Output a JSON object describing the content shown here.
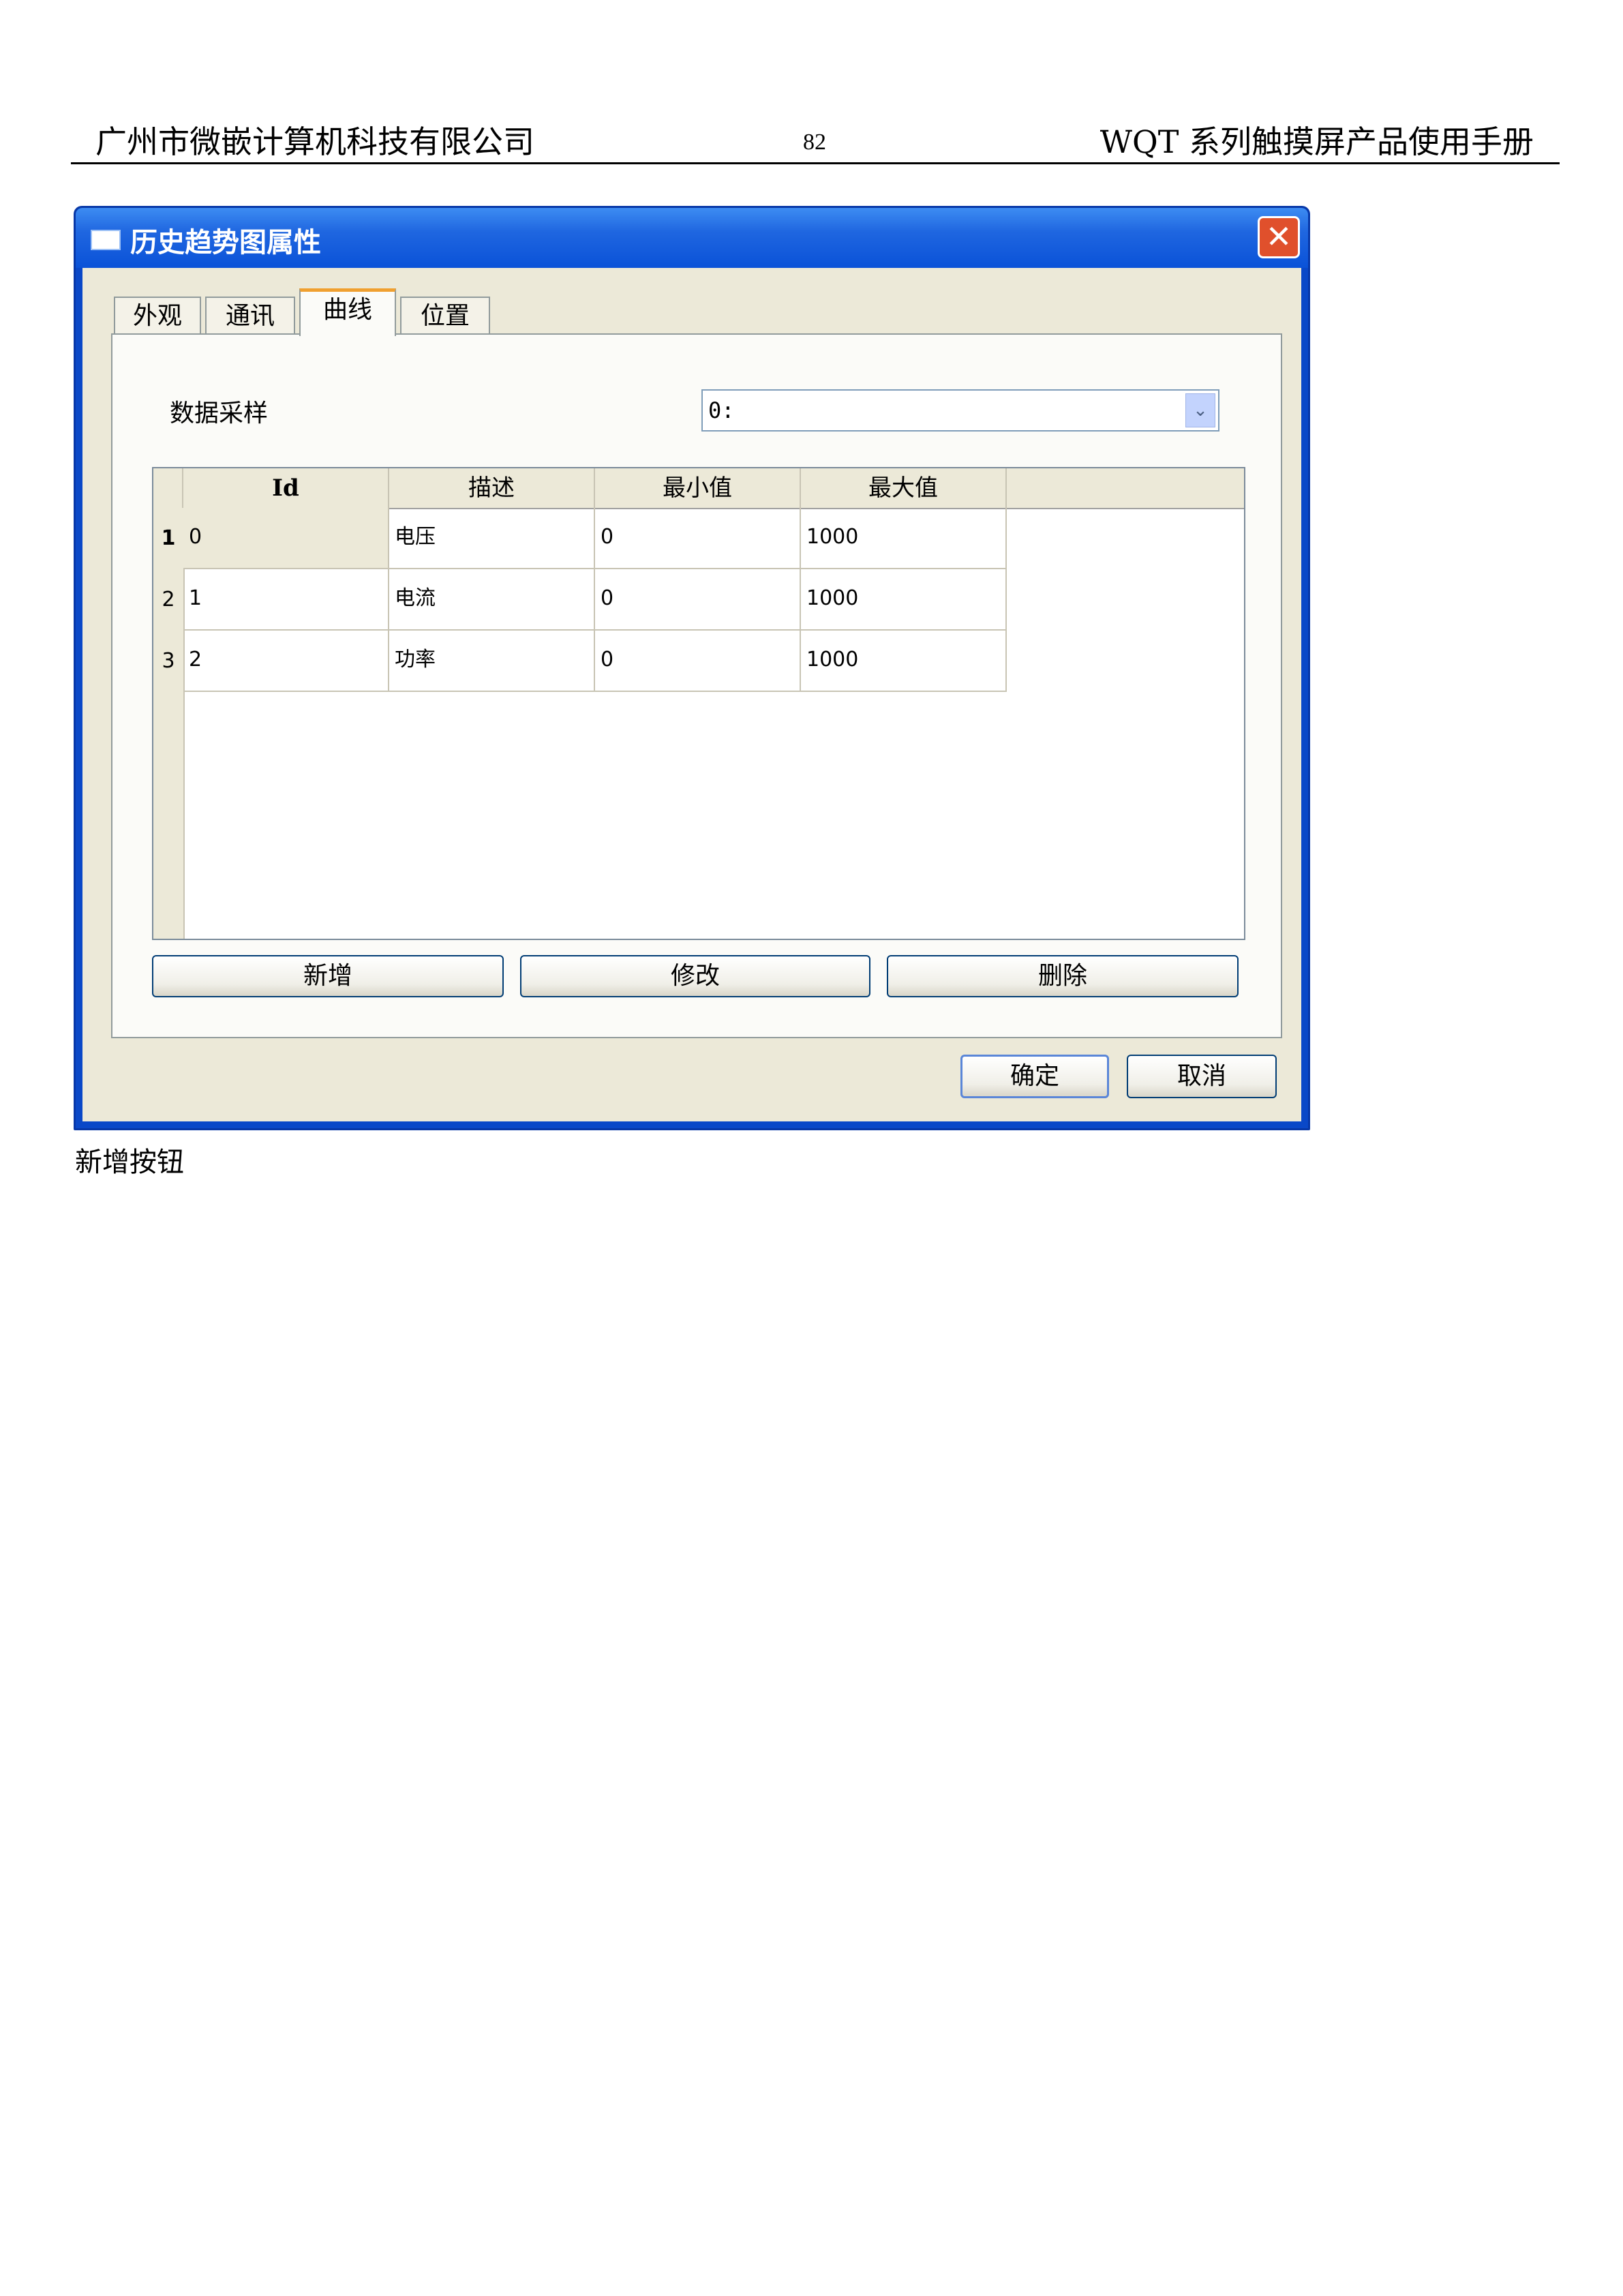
{
  "doc_header": {
    "company": "广州市微嵌计算机科技有限公司",
    "page_number": "82",
    "manual_title": "WQT 系列触摸屏产品使用手册"
  },
  "window": {
    "title": "历史趋势图属性",
    "close_label": "✕"
  },
  "tabs": [
    {
      "label": "外观"
    },
    {
      "label": "通讯"
    },
    {
      "label": "曲线"
    },
    {
      "label": "位置"
    }
  ],
  "active_tab": "曲线",
  "sampling": {
    "label": "数据采样",
    "value": "0:",
    "arrow": "⌄"
  },
  "grid": {
    "columns": [
      "Id",
      "描述",
      "最小值",
      "最大值"
    ],
    "rows": [
      {
        "num": "1",
        "id": "0",
        "desc": "电压",
        "min": "0",
        "max": "1000"
      },
      {
        "num": "2",
        "id": "1",
        "desc": "电流",
        "min": "0",
        "max": "1000"
      },
      {
        "num": "3",
        "id": "2",
        "desc": "功率",
        "min": "0",
        "max": "1000"
      }
    ]
  },
  "buttons": {
    "add": "新增",
    "edit": "修改",
    "delete": "删除",
    "ok": "确定",
    "cancel": "取消"
  },
  "caption": "新增按钮"
}
